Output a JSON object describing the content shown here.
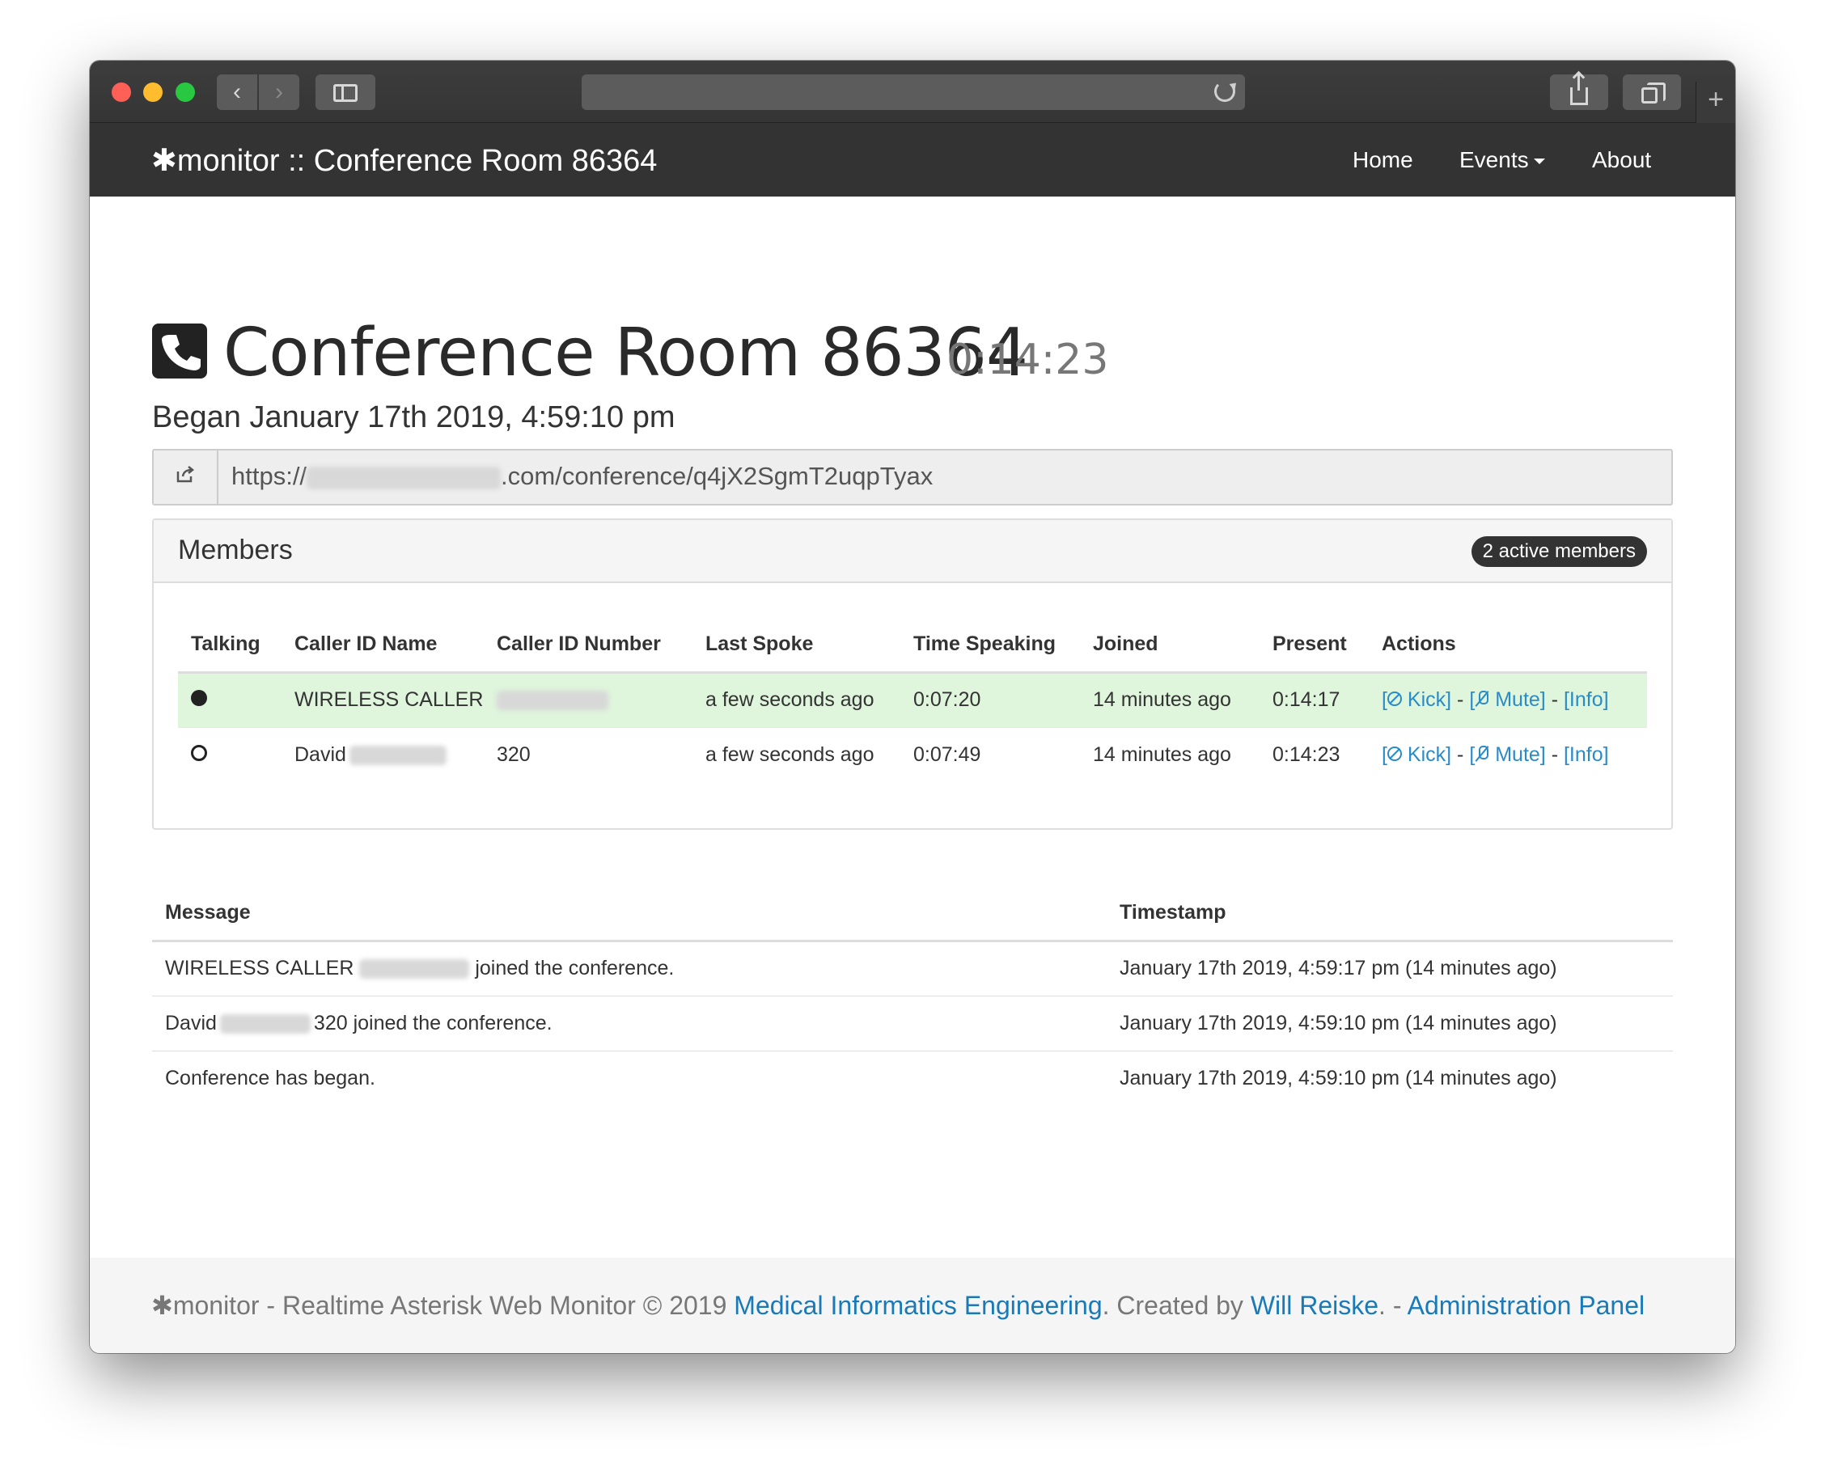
{
  "navbar": {
    "brand_symbol": "✱",
    "brand_text": "monitor :: Conference Room 86364",
    "items": [
      {
        "label": "Home"
      },
      {
        "label": "Events"
      },
      {
        "label": "About"
      }
    ]
  },
  "header": {
    "title": "Conference Room 86364",
    "elapsed": "0:14:23",
    "began": "Began January 17th 2019, 4:59:10 pm"
  },
  "conference_url": {
    "prefix": "https://",
    "suffix": ".com/conference/q4jX2SgmT2uqpTyax"
  },
  "members_panel": {
    "title": "Members",
    "badge": "2 active members",
    "columns": [
      "Talking",
      "Caller ID Name",
      "Caller ID Number",
      "Last Spoke",
      "Time Speaking",
      "Joined",
      "Present",
      "Actions"
    ],
    "rows": [
      {
        "talking": true,
        "caller_id_name": "WIRELESS CALLER",
        "caller_id_number": "",
        "last_spoke": "a few seconds ago",
        "time_speaking": "0:07:20",
        "joined": "14 minutes ago",
        "present": "0:14:17"
      },
      {
        "talking": false,
        "caller_id_name": "David",
        "caller_id_number": "320",
        "last_spoke": "a few seconds ago",
        "time_speaking": "0:07:49",
        "joined": "14 minutes ago",
        "present": "0:14:23"
      }
    ],
    "actions": {
      "kick": "Kick]",
      "mute": "Mute]",
      "info": "[Info]",
      "bracket_open": "[",
      "separator": " - "
    }
  },
  "messages": {
    "columns": [
      "Message",
      "Timestamp"
    ],
    "rows": [
      {
        "msg_a": "WIRELESS CALLER",
        "msg_b": "joined the conference.",
        "timestamp": "January 17th 2019, 4:59:17 pm (14 minutes ago)"
      },
      {
        "msg_a": "David",
        "msg_b": "320 joined the conference.",
        "timestamp": "January 17th 2019, 4:59:10 pm (14 minutes ago)"
      },
      {
        "msg_a": "Conference has began.",
        "msg_b": "",
        "timestamp": "January 17th 2019, 4:59:10 pm (14 minutes ago)"
      }
    ]
  },
  "footer": {
    "symbol": "✱",
    "text_1": "monitor - Realtime Asterisk Web Monitor © 2019 ",
    "link_1": "Medical Informatics Engineering",
    "text_2": ". Created by ",
    "link_2": "Will Reiske",
    "text_3": ". - ",
    "link_3": "Administration Panel"
  },
  "icons": {
    "back": "chevron-left-icon",
    "forward": "chevron-right-icon",
    "sidebar": "sidebar-icon",
    "reload": "reload-icon",
    "share": "share-icon",
    "tabs": "tabs-icon",
    "new_tab": "plus-icon",
    "phone": "phone-icon",
    "url_addon": "share-link-icon"
  },
  "colors": {
    "navbar_bg": "#333333",
    "link": "#2a8bc9",
    "talking_row": "#dff5dc",
    "badge_bg": "#333333"
  }
}
